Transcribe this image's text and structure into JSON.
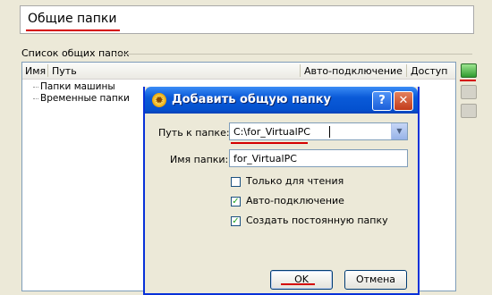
{
  "header": {
    "title": "Общие папки"
  },
  "group": {
    "label": "Список общих папок"
  },
  "list": {
    "columns": [
      "Имя",
      "Путь",
      "Авто-подключение",
      "Доступ"
    ],
    "items": [
      "Папки машины",
      "Временные папки"
    ]
  },
  "toolbar": {
    "icons": [
      "add-folder-icon",
      "edit-folder-icon",
      "remove-folder-icon"
    ]
  },
  "dialog": {
    "title": "Добавить общую папку",
    "help_label": "?",
    "close_label": "✕",
    "path_label": "Путь к папке:",
    "path_value": "C:\\for_VirtualPC",
    "name_label": "Имя папки:",
    "name_value": "for_VirtualPC",
    "readonly_label": "Только для чтения",
    "readonly_checked": false,
    "auto_label": "Авто-подключение",
    "auto_checked": true,
    "permanent_label": "Создать постоянную папку",
    "permanent_checked": true,
    "ok_label": "OK",
    "cancel_label": "Отмена"
  },
  "colors": {
    "annotation_red": "#d40000",
    "titlebar_blue": "#0a5ad8",
    "window_bg": "#ece9d8"
  }
}
